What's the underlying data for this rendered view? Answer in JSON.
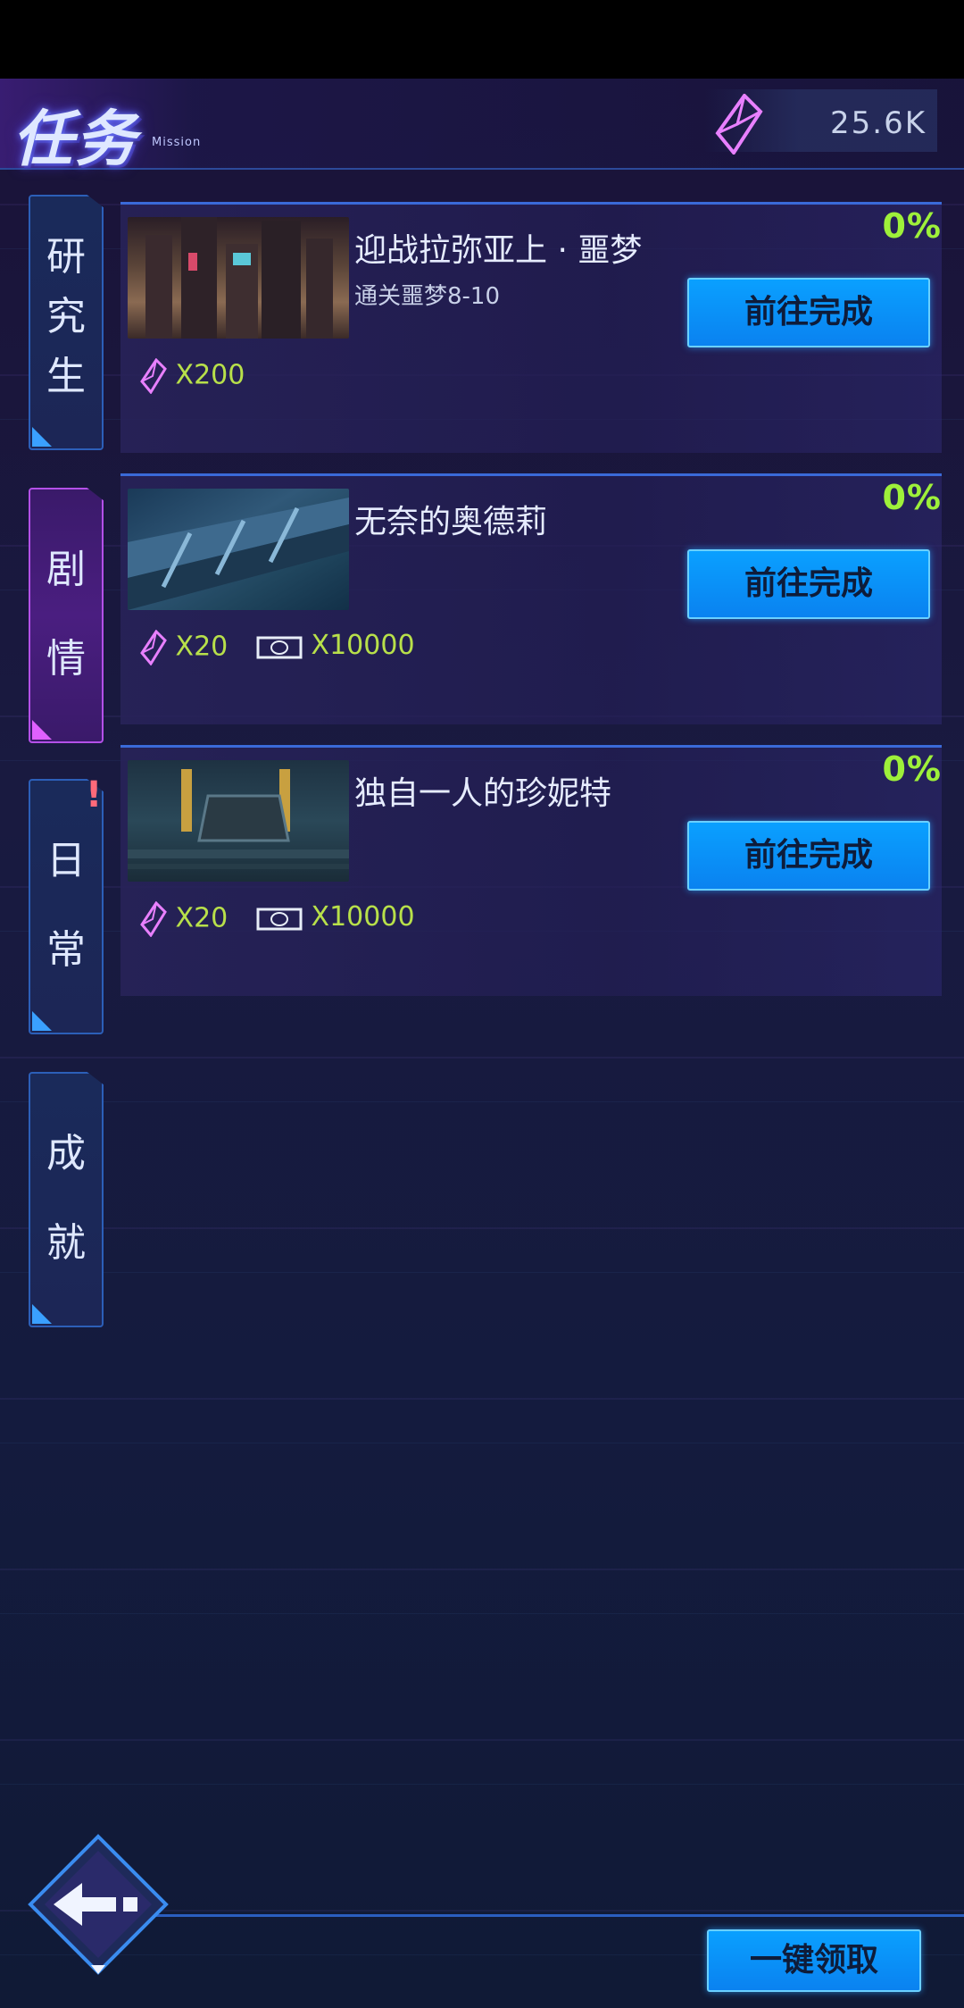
{
  "header": {
    "title": "任务",
    "subtitle": "Mission",
    "currency_value": "25.6K"
  },
  "tabs": [
    {
      "label_line1": "研",
      "label_line2": "究",
      "label_line3": "生",
      "active": false
    },
    {
      "label_line1": "剧",
      "label_line2": "情",
      "active": true
    },
    {
      "label_line1": "日",
      "label_line2": "常",
      "active": false,
      "alert": "!"
    },
    {
      "label_line1": "成",
      "label_line2": "就",
      "active": false
    }
  ],
  "missions": [
    {
      "title": "迎战拉弥亚上 · 噩梦",
      "subtitle": "通关噩梦8-10",
      "progress": "0%",
      "button": "前往完成",
      "reward_crystal": "X200"
    },
    {
      "title": "无奈的奥德莉",
      "subtitle": "",
      "progress": "0%",
      "button": "前往完成",
      "reward_crystal": "X20",
      "reward_cash": "X10000"
    },
    {
      "title": "独自一人的珍妮特",
      "subtitle": "",
      "progress": "0%",
      "button": "前往完成",
      "reward_crystal": "X20",
      "reward_cash": "X10000"
    }
  ],
  "footer": {
    "claim_all": "一键领取"
  },
  "colors": {
    "accent_blue": "#0a90ff",
    "progress_green": "#9ef03a",
    "crystal_pink": "#e060ff"
  }
}
